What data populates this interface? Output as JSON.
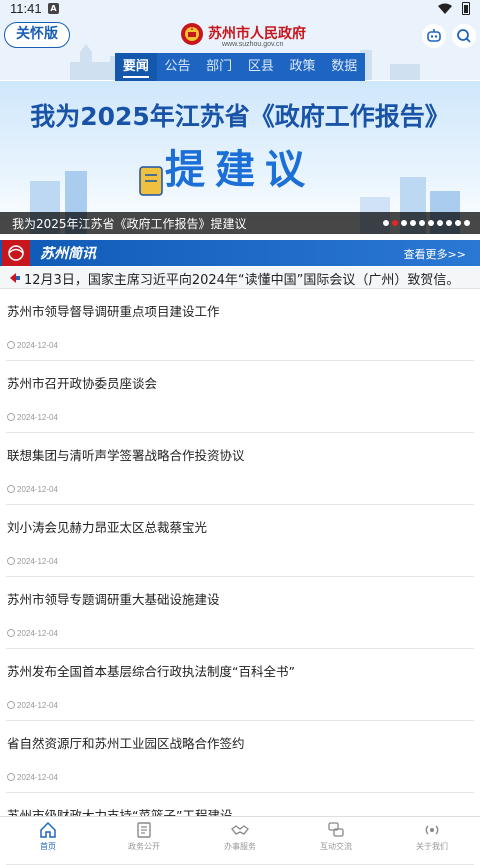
{
  "status_bar": {
    "time": "11:41",
    "notification_glyph": "A"
  },
  "header": {
    "care_label": "关怀版",
    "site_title": "苏州市人民政府",
    "site_domain": "www.suzhou.gov.cn",
    "tabs": [
      {
        "label": "要闻",
        "active": true
      },
      {
        "label": "公告",
        "active": false
      },
      {
        "label": "部门",
        "active": false
      },
      {
        "label": "区县",
        "active": false
      },
      {
        "label": "政策",
        "active": false
      },
      {
        "label": "数据",
        "active": false
      }
    ]
  },
  "banner": {
    "title": "我为2025年江苏省《政府工作报告》",
    "subtitle": "提建议",
    "caption": "我为2025年江苏省《政府工作报告》提建议",
    "slide_count": 10,
    "active_slide": 1
  },
  "news_section": {
    "title": "苏州简讯",
    "more_label": "查看更多>>",
    "ticker": "12月3日，国家主席习近平向2024年“读懂中国”国际会议（广州）致贺信。",
    "items": [
      {
        "title": "苏州市领导督导调研重点项目建设工作",
        "date": "2024-12-04"
      },
      {
        "title": "苏州市召开政协委员座谈会",
        "date": "2024-12-04"
      },
      {
        "title": "联想集团与清听声学签署战略合作投资协议",
        "date": "2024-12-04"
      },
      {
        "title": "刘小涛会见赫力昂亚太区总裁蔡宝光",
        "date": "2024-12-04"
      },
      {
        "title": "苏州市领导专题调研重大基础设施建设",
        "date": "2024-12-04"
      },
      {
        "title": "苏州发布全国首本基层综合行政执法制度“百科全书”",
        "date": "2024-12-04"
      },
      {
        "title": "省自然资源厅和苏州工业园区战略合作签约",
        "date": "2024-12-04"
      },
      {
        "title": "苏州市级财政大力支持“菜篮子”工程建设",
        "date": ""
      }
    ]
  },
  "bottom_nav": [
    {
      "label": "首页",
      "icon": "home-icon",
      "active": true
    },
    {
      "label": "政务公开",
      "icon": "document-icon",
      "active": false
    },
    {
      "label": "办事服务",
      "icon": "handshake-icon",
      "active": false
    },
    {
      "label": "互动交流",
      "icon": "chat-icon",
      "active": false
    },
    {
      "label": "关于我们",
      "icon": "broadcast-icon",
      "active": false
    }
  ],
  "colors": {
    "brand_blue": "#1d65c1",
    "brand_red": "#c8161d",
    "tab_bg": "#1d65c1"
  }
}
